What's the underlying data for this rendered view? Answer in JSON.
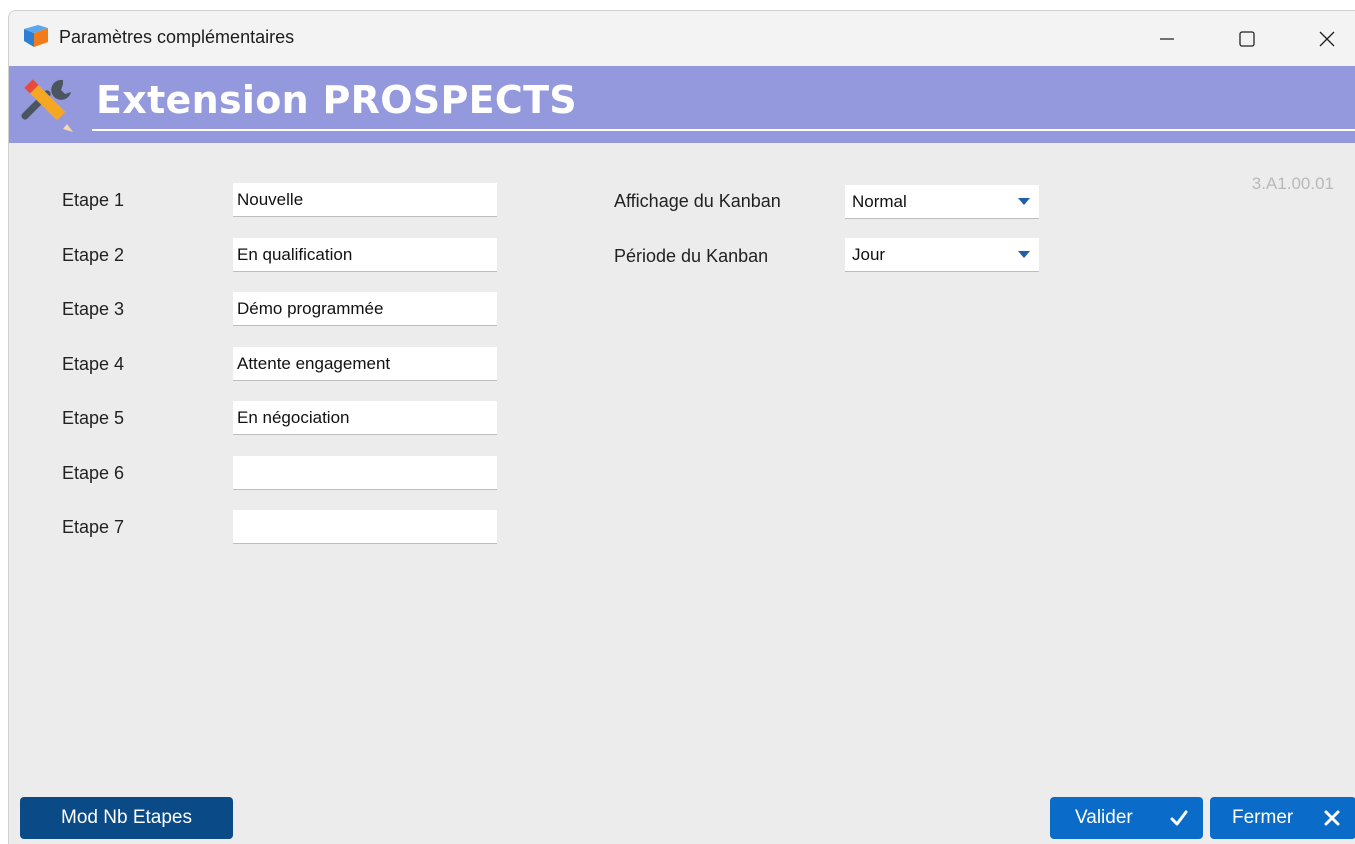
{
  "window": {
    "title": "Paramètres complémentaires"
  },
  "banner": {
    "title": "Extension PROSPECTS"
  },
  "version": "3.A1.00.01",
  "etapes": [
    {
      "label": "Etape 1",
      "value": "Nouvelle"
    },
    {
      "label": "Etape 2",
      "value": "En qualification"
    },
    {
      "label": "Etape 3",
      "value": "Démo programmée"
    },
    {
      "label": "Etape 4",
      "value": "Attente engagement"
    },
    {
      "label": "Etape 5",
      "value": "En négociation"
    },
    {
      "label": "Etape 6",
      "value": ""
    },
    {
      "label": "Etape 7",
      "value": ""
    }
  ],
  "kanban": {
    "affichage_label": "Affichage du Kanban",
    "affichage_value": "Normal",
    "periode_label": "Période du Kanban",
    "periode_value": "Jour"
  },
  "buttons": {
    "mod": "Mod Nb Etapes",
    "valider": "Valider",
    "fermer": "Fermer"
  },
  "colors": {
    "banner": "#9399dc",
    "primary_button": "#0b6bc8",
    "secondary_button": "#0a4a87"
  }
}
